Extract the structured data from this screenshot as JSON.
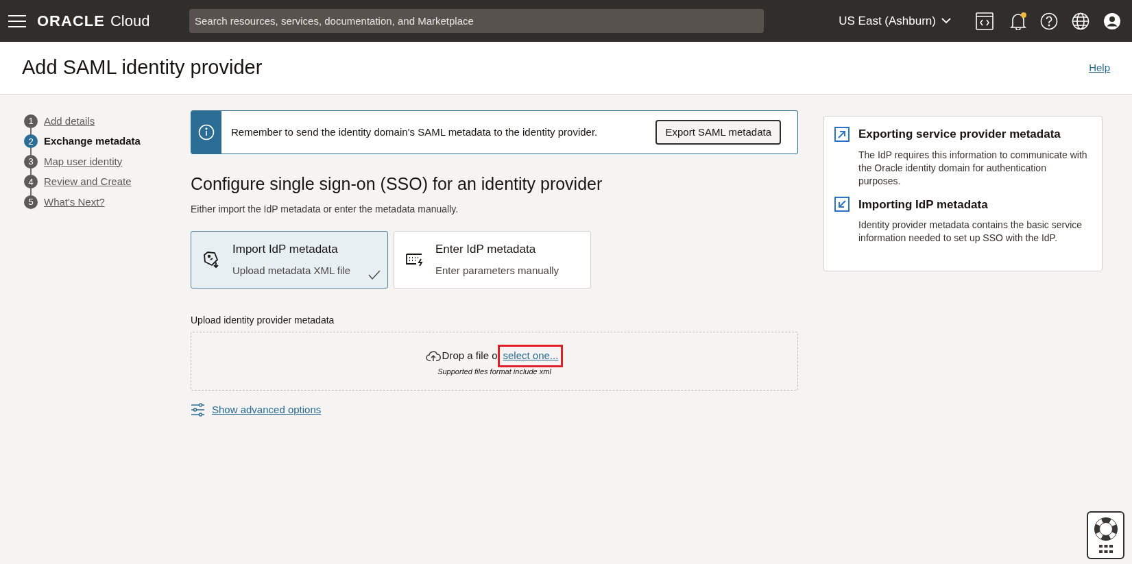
{
  "header": {
    "brand": "ORACLE",
    "brand_suffix": "Cloud",
    "search": {
      "placeholder": "Search resources, services, documentation, and Marketplace"
    },
    "region": "US East (Ashburn)",
    "notification_dot": true
  },
  "page": {
    "title": "Add SAML identity provider",
    "help": "Help"
  },
  "steps": [
    {
      "number": "1",
      "label": "Add details",
      "selected": false
    },
    {
      "number": "2",
      "label": "Exchange metadata",
      "selected": true
    },
    {
      "number": "3",
      "label": "Map user identity",
      "selected": false
    },
    {
      "number": "4",
      "label": "Review and Create",
      "selected": false
    },
    {
      "number": "5",
      "label": "What's Next?",
      "selected": false
    }
  ],
  "banner": {
    "message": "Remember to send the identity domain's SAML metadata to the identity provider.",
    "button": "Export SAML metadata"
  },
  "section": {
    "title": "Configure single sign-on (SSO) for an identity provider",
    "subtitle": "Either import the IdP metadata or enter the metadata manually."
  },
  "options": [
    {
      "kind": "import",
      "title": "Import IdP metadata",
      "description": "Upload metadata XML file",
      "selected": true
    },
    {
      "kind": "enter",
      "title": "Enter IdP metadata",
      "description": "Enter parameters manually",
      "selected": false
    }
  ],
  "upload": {
    "label": "Upload identity provider metadata",
    "drop_text": "Drop a file o",
    "link": "select one...",
    "hint": "Supported files format include xml"
  },
  "advanced": "Show advanced options",
  "help_panel": [
    {
      "kind": "export",
      "title": "Exporting service provider metadata",
      "text": "The IdP requires this information to communicate with the Oracle identity domain for authentication purposes."
    },
    {
      "kind": "import",
      "title": "Importing IdP metadata",
      "text": "Identity provider metadata contains the basic service information needed to set up SSO with the IdP."
    }
  ]
}
